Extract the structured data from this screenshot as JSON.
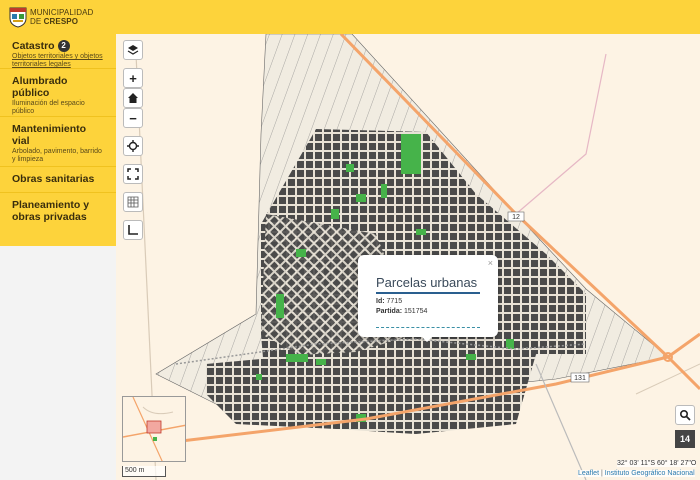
{
  "header": {
    "brand_line1": "MUNICIPALIDAD",
    "brand_line2a": "DE ",
    "brand_line2b": "CRESPO"
  },
  "sidebar": {
    "items": [
      {
        "title": "Catastro",
        "badge": "2",
        "subtitle": "Objetos territoriales y objetos territoriales legales"
      },
      {
        "title": "Alumbrado público",
        "subtitle": "Iluminación del espacio público"
      },
      {
        "title": "Mantenimiento vial",
        "subtitle": "Arbolado, pavimento, barrido y limpieza"
      },
      {
        "title": "Obras sanitarias",
        "subtitle": ""
      },
      {
        "title": "Planeamiento y obras privadas",
        "subtitle": ""
      }
    ]
  },
  "map": {
    "controls": {
      "zoom_in": "+",
      "zoom_out": "−"
    },
    "road_labels": {
      "r12": "12",
      "r131": "131"
    },
    "popup": {
      "title": "Parcelas urbanas",
      "id_label": "Id:",
      "id_value": "7715",
      "partida_label": "Partida:",
      "partida_value": "151754",
      "close": "×"
    },
    "scale": "500 m",
    "zoom_level": "14",
    "coordinates": "32° 03' 11\"S 60° 18' 27\"O",
    "attribution_leaflet": "Leaflet",
    "attribution_sep": " | ",
    "attribution_ign": "Instituto Geográfico Nacional"
  },
  "colors": {
    "header_bg": "#fdd33b",
    "map_bg": "#fdf3e4",
    "block_fill": "#4a4a4a",
    "green_space": "#46b34a",
    "road_orange": "#f4a46a"
  }
}
